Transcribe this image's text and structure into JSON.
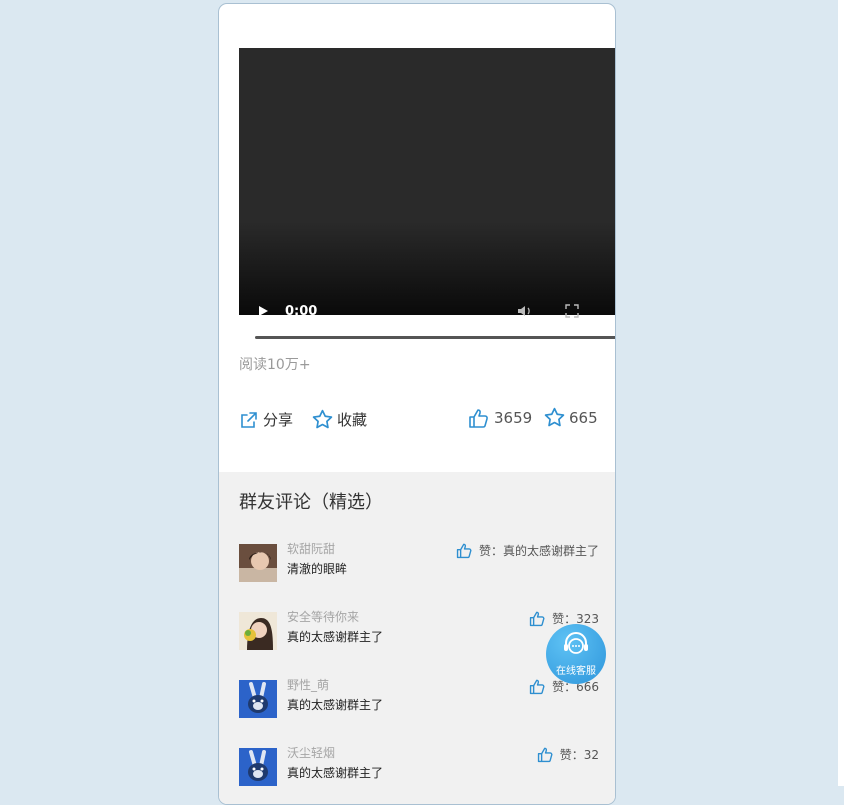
{
  "video": {
    "time": "0:00",
    "progress": 0
  },
  "stats": {
    "reads": "阅读10万+"
  },
  "actions": {
    "share_label": "分享",
    "collect_label": "收藏",
    "like_count": "3659",
    "star_count": "665"
  },
  "comments": {
    "title": "群友评论（精选）",
    "items": [
      {
        "name": "软甜阮甜",
        "text": "清澈的眼眸",
        "like": "赞：真的太感谢群主了"
      },
      {
        "name": "安全等待你来",
        "text": "真的太感谢群主了",
        "like": "赞：323"
      },
      {
        "name": "野性_萌",
        "text": "真的太感谢群主了",
        "like": "赞：666"
      },
      {
        "name": "沃尘轻烟",
        "text": "真的太感谢群主了",
        "like": "赞：32"
      }
    ]
  },
  "service": {
    "label": "在线客服"
  },
  "colors": {
    "accent": "#2e8fd0",
    "background": "#dbe8f1",
    "comments_bg": "#f1f1f1"
  }
}
